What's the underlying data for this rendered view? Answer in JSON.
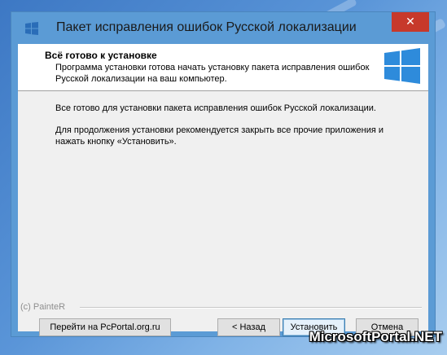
{
  "window": {
    "title": "Пакет исправления ошибок Русской локализации",
    "close_glyph": "✕"
  },
  "header": {
    "title": "Всё готово к установке",
    "description": "Программа установки готова начать установку пакета исправления ошибок Русской локализации на ваш компьютер."
  },
  "body": {
    "paragraph1": "Все готово для установки пакета исправления ошибок Русской локализации.",
    "paragraph2": "Для продолжения установки рекомендуется закрыть все прочие приложения и нажать кнопку «Установить»."
  },
  "footer": {
    "credit": "(c) PainteR",
    "portal_label": "Перейти на PcPortal.org.ru",
    "back_label": "< Назад",
    "install_label": "Установить",
    "cancel_label": "Отмена"
  },
  "watermark": "MicrosoftPortal.NET",
  "icons": {
    "app": "windows-logo-icon",
    "header": "windows-logo-icon",
    "close": "close-icon"
  },
  "colors": {
    "titlebar": "#5b9bd5",
    "close": "#c7392b",
    "logo": "#2e8bdb"
  }
}
